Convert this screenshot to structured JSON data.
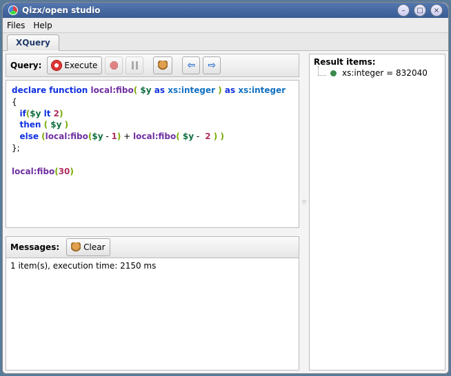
{
  "window": {
    "title": "Qizx/open studio"
  },
  "menubar": {
    "files": "Files",
    "help": "Help"
  },
  "tabs": {
    "xquery": "XQuery"
  },
  "toolbar": {
    "query_label": "Query:",
    "execute_label": "Execute"
  },
  "editor": {
    "code_tokens": [
      {
        "t": "kw",
        "v": "declare function "
      },
      {
        "t": "fn",
        "v": "local:fibo"
      },
      {
        "t": "par",
        "v": "( "
      },
      {
        "t": "var",
        "v": "$y"
      },
      {
        "t": "kw",
        "v": " as "
      },
      {
        "t": "typ",
        "v": "xs:integer"
      },
      {
        "t": "par",
        "v": " )"
      },
      {
        "t": "kw",
        "v": " as "
      },
      {
        "t": "typ",
        "v": "xs:integer"
      },
      {
        "t": "nl"
      },
      {
        "t": "txt",
        "v": "{"
      },
      {
        "t": "nl"
      },
      {
        "t": "txt",
        "v": "   "
      },
      {
        "t": "kw",
        "v": "if"
      },
      {
        "t": "par",
        "v": "("
      },
      {
        "t": "var",
        "v": "$y"
      },
      {
        "t": "kw",
        "v": " lt "
      },
      {
        "t": "num",
        "v": "2"
      },
      {
        "t": "par",
        "v": ")"
      },
      {
        "t": "nl"
      },
      {
        "t": "txt",
        "v": "   "
      },
      {
        "t": "kw",
        "v": "then "
      },
      {
        "t": "par",
        "v": "( "
      },
      {
        "t": "var",
        "v": "$y"
      },
      {
        "t": "par",
        "v": " )"
      },
      {
        "t": "nl"
      },
      {
        "t": "txt",
        "v": "   "
      },
      {
        "t": "kw",
        "v": "else "
      },
      {
        "t": "par",
        "v": "("
      },
      {
        "t": "fn",
        "v": "local:fibo"
      },
      {
        "t": "par",
        "v": "("
      },
      {
        "t": "var",
        "v": "$y"
      },
      {
        "t": "txt",
        "v": " - "
      },
      {
        "t": "num",
        "v": "1"
      },
      {
        "t": "par",
        "v": ")"
      },
      {
        "t": "txt",
        "v": " + "
      },
      {
        "t": "fn",
        "v": "local:fibo"
      },
      {
        "t": "par",
        "v": "( "
      },
      {
        "t": "var",
        "v": "$y"
      },
      {
        "t": "txt",
        "v": " - "
      },
      {
        "t": "num",
        "v": " 2 "
      },
      {
        "t": "par",
        "v": ") )"
      },
      {
        "t": "nl"
      },
      {
        "t": "txt",
        "v": "};"
      },
      {
        "t": "nl"
      },
      {
        "t": "nl"
      },
      {
        "t": "fn",
        "v": "local:fibo"
      },
      {
        "t": "par",
        "v": "("
      },
      {
        "t": "num",
        "v": "30"
      },
      {
        "t": "par",
        "v": ")"
      }
    ]
  },
  "messages": {
    "label": "Messages:",
    "clear_label": "Clear",
    "body": "1 item(s), execution time: 2150 ms"
  },
  "results": {
    "label": "Result items:",
    "item": "xs:integer = 832040"
  }
}
